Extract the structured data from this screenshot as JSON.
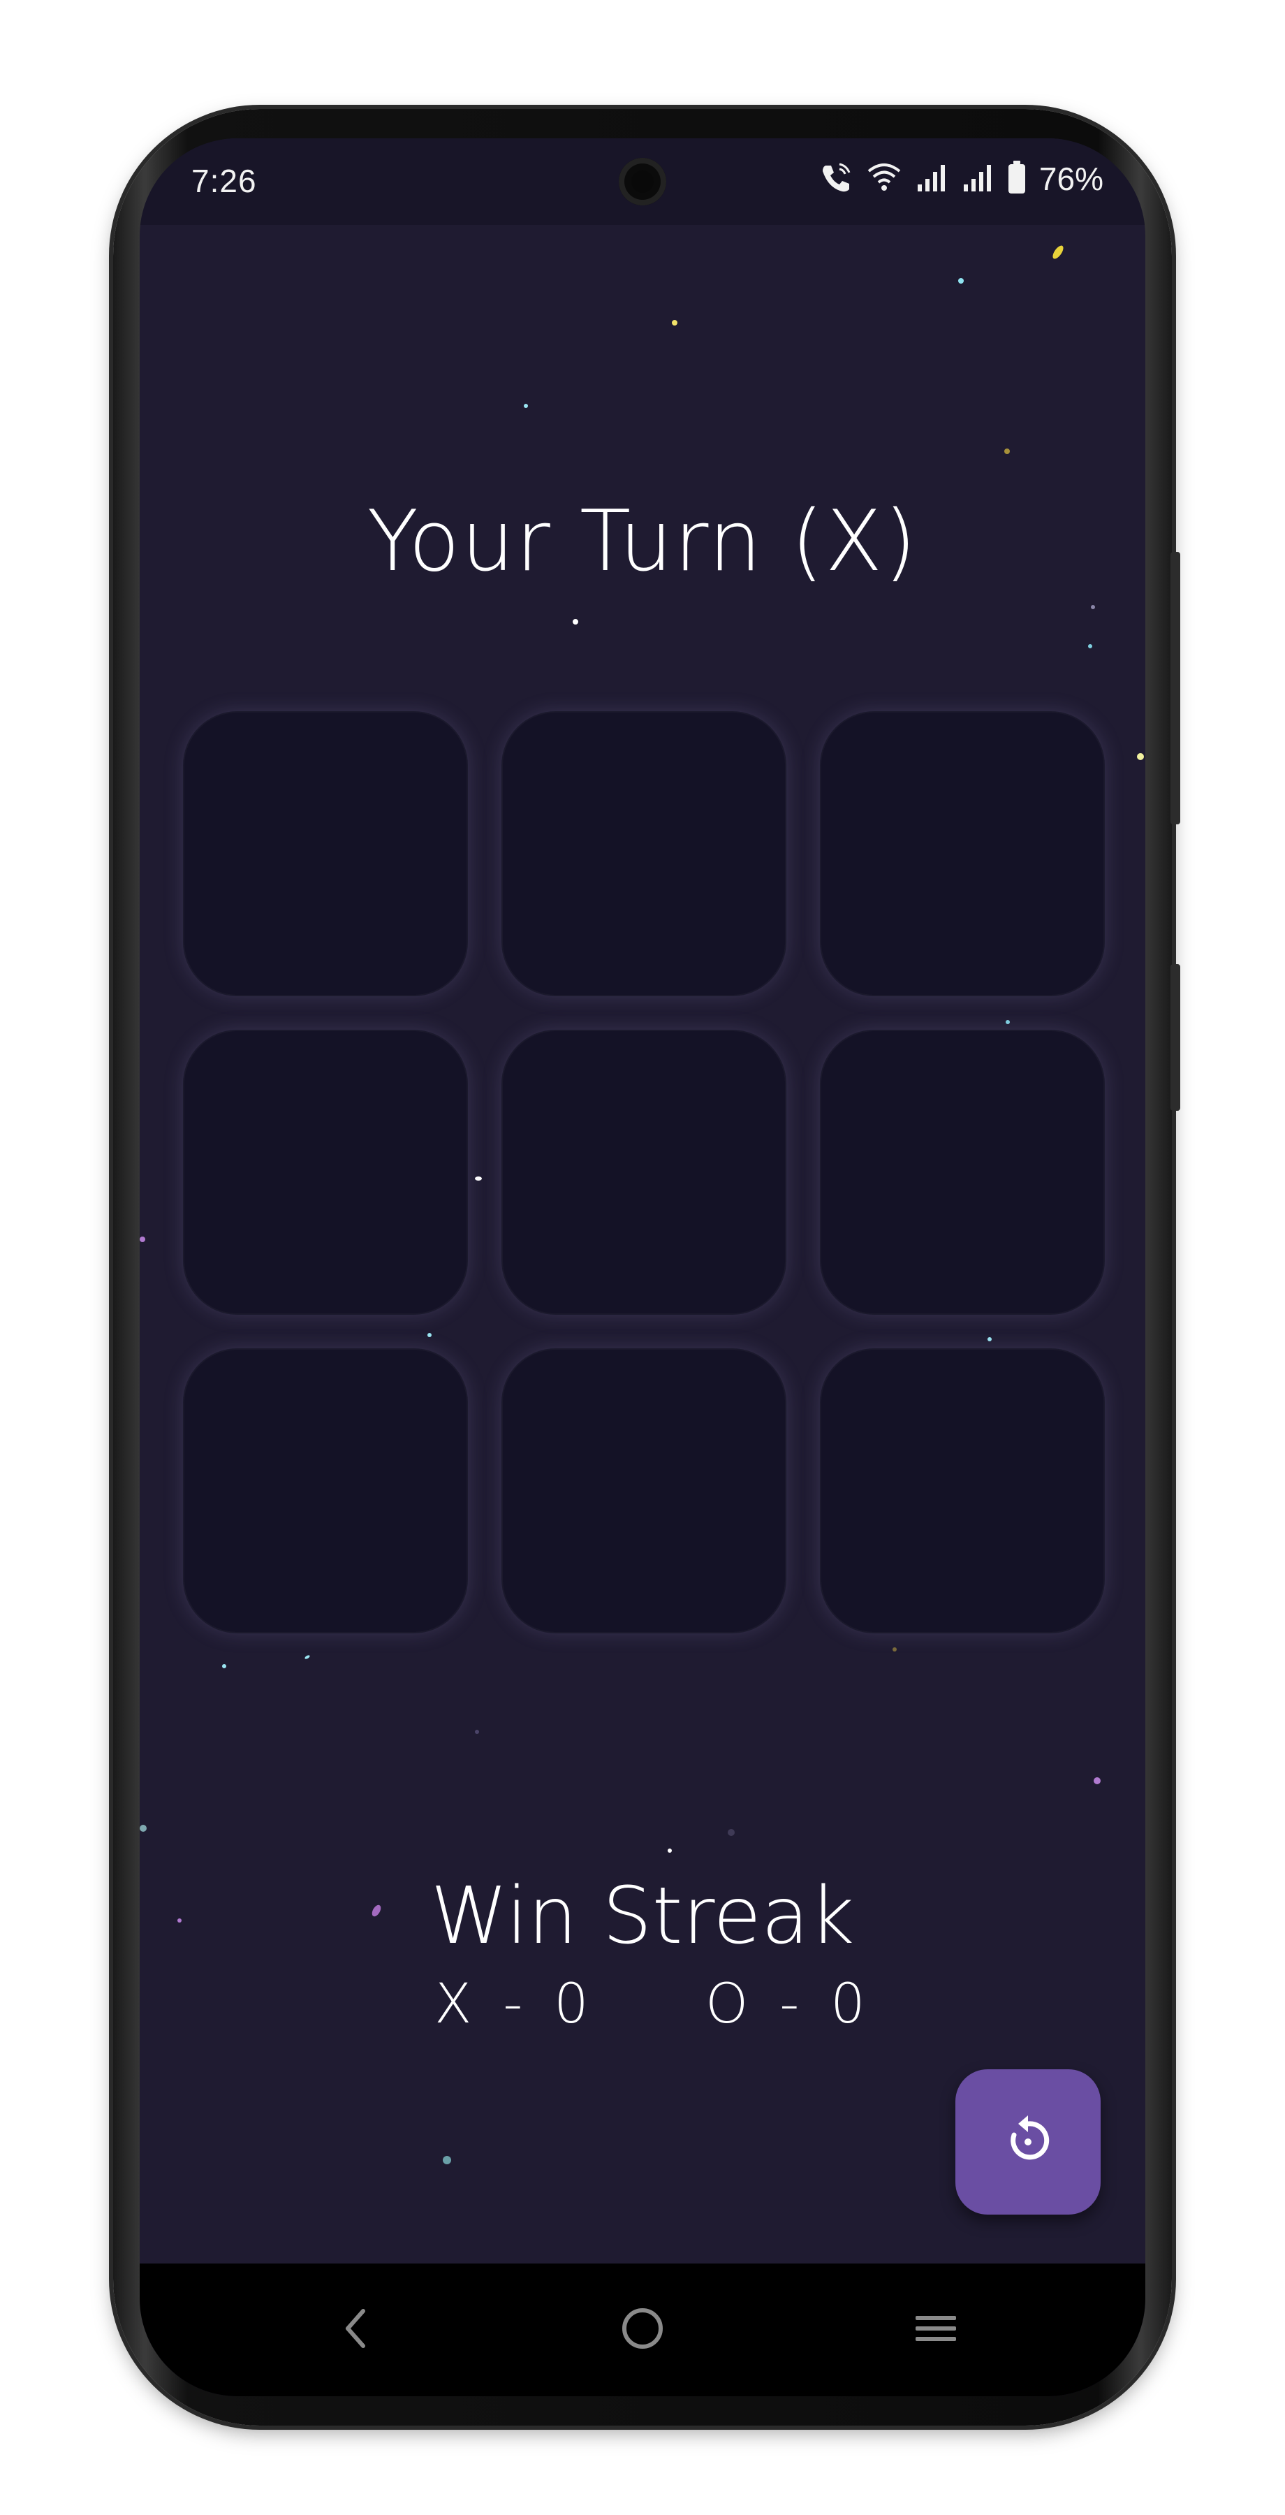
{
  "status_bar": {
    "time": "7:26",
    "battery_percent": "76%",
    "icons": [
      "wifi-calling-icon",
      "wifi-icon",
      "signal-icon",
      "signal-icon",
      "battery-icon"
    ]
  },
  "game": {
    "turn_label": "Your Turn (X)",
    "board": [
      "",
      "",
      "",
      "",
      "",
      "",
      "",
      "",
      ""
    ]
  },
  "streak": {
    "title": "Win Streak",
    "x_score": "X - 0",
    "o_score": "O - 0"
  },
  "actions": {
    "restart_icon": "restart-icon"
  },
  "nav": {
    "icons": [
      "back-icon",
      "home-icon",
      "recents-icon"
    ]
  },
  "colors": {
    "background": "#1f1b31",
    "cell": "#141226",
    "accent": "#6a4ea3"
  }
}
